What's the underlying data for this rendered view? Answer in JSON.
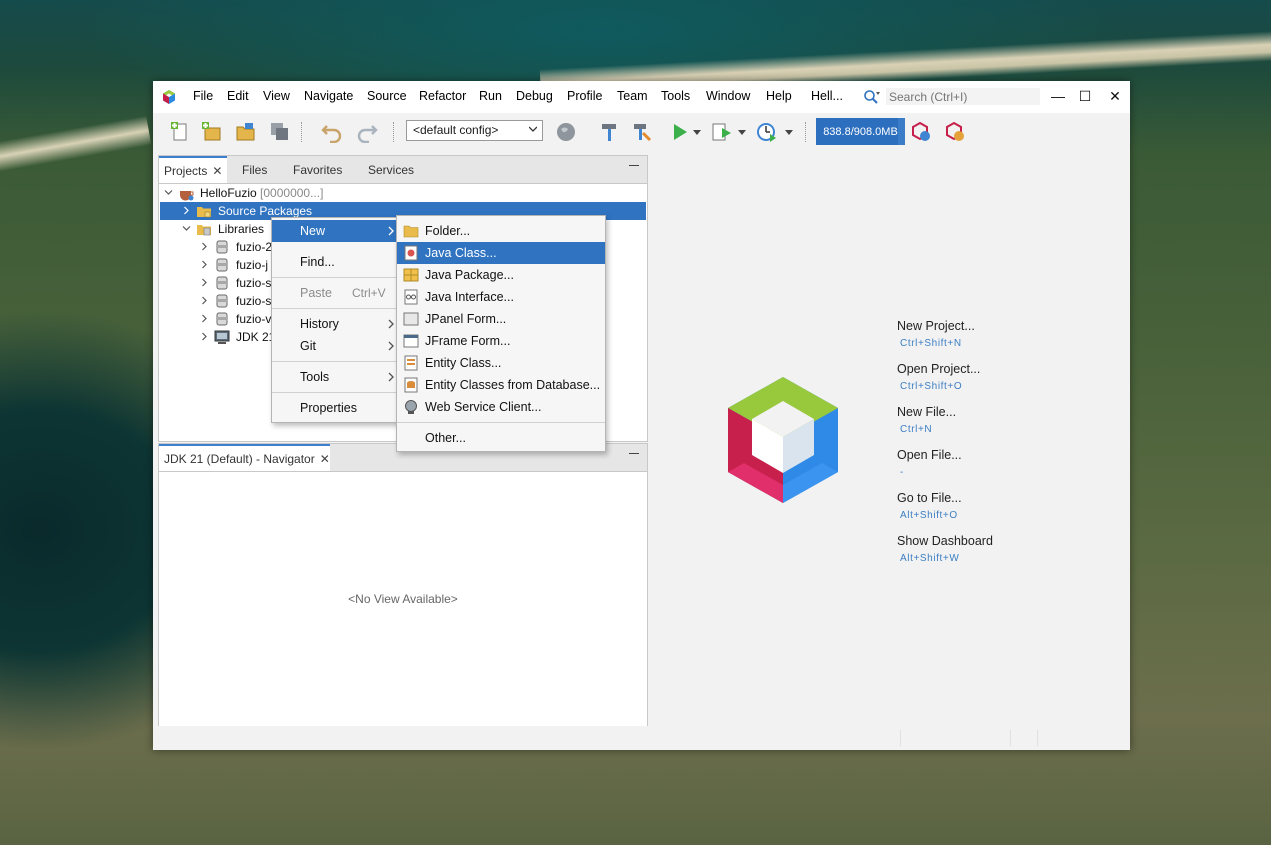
{
  "menubar": {
    "items": [
      "File",
      "Edit",
      "View",
      "Navigate",
      "Source",
      "Refactor",
      "Run",
      "Debug",
      "Profile",
      "Team",
      "Tools",
      "Window",
      "Help",
      "Hell..."
    ],
    "search_placeholder": "Search (Ctrl+I)",
    "minimize": "—",
    "maximize": "☐",
    "close": "✕"
  },
  "toolbar": {
    "config": "<default config>",
    "memory": "838.8/908.0MB",
    "memory_fraction": 0.92
  },
  "projects": {
    "tabs": [
      "Projects",
      "Files",
      "Favorites",
      "Services"
    ],
    "tree": {
      "project": "HelloFuzio",
      "project_suffix": "[0000000...]",
      "source_packages": "Source Packages",
      "libraries": "Libraries",
      "libs": [
        "fuzio-2",
        "fuzio-j",
        "fuzio-s",
        "fuzio-s",
        "fuzio-v"
      ],
      "jdk": "JDK 21"
    }
  },
  "navigator": {
    "tab": "JDK 21 (Default) - Navigator",
    "empty": "<No View Available>"
  },
  "context_menu": {
    "new": "New",
    "find": "Find...",
    "paste": "Paste",
    "paste_shortcut": "Ctrl+V",
    "history": "History",
    "git": "Git",
    "tools": "Tools",
    "properties": "Properties"
  },
  "new_submenu": [
    {
      "label": "Folder...",
      "icon": "folder-icon"
    },
    {
      "label": "Java Class...",
      "icon": "java-class-icon"
    },
    {
      "label": "Java Package...",
      "icon": "java-package-icon"
    },
    {
      "label": "Java Interface...",
      "icon": "java-interface-icon"
    },
    {
      "label": "JPanel Form...",
      "icon": "jpanel-form-icon"
    },
    {
      "label": "JFrame Form...",
      "icon": "jframe-form-icon"
    },
    {
      "label": "Entity Class...",
      "icon": "entity-class-icon"
    },
    {
      "label": "Entity Classes from Database...",
      "icon": "entity-db-icon"
    },
    {
      "label": "Web Service Client...",
      "icon": "web-service-icon"
    },
    {
      "label": "Other...",
      "icon": ""
    }
  ],
  "start_page": {
    "actions": [
      {
        "label": "New Project...",
        "shortcut": "Ctrl+Shift+N"
      },
      {
        "label": "Open Project...",
        "shortcut": "Ctrl+Shift+O"
      },
      {
        "label": "New File...",
        "shortcut": "Ctrl+N"
      },
      {
        "label": "Open File...",
        "shortcut": "-"
      },
      {
        "label": "Go to File...",
        "shortcut": "Alt+Shift+O"
      },
      {
        "label": "Show Dashboard",
        "shortcut": "Alt+Shift+W"
      }
    ]
  },
  "colors": {
    "accent": "#2f73c1",
    "memory_bar": "#3a7cc7"
  }
}
